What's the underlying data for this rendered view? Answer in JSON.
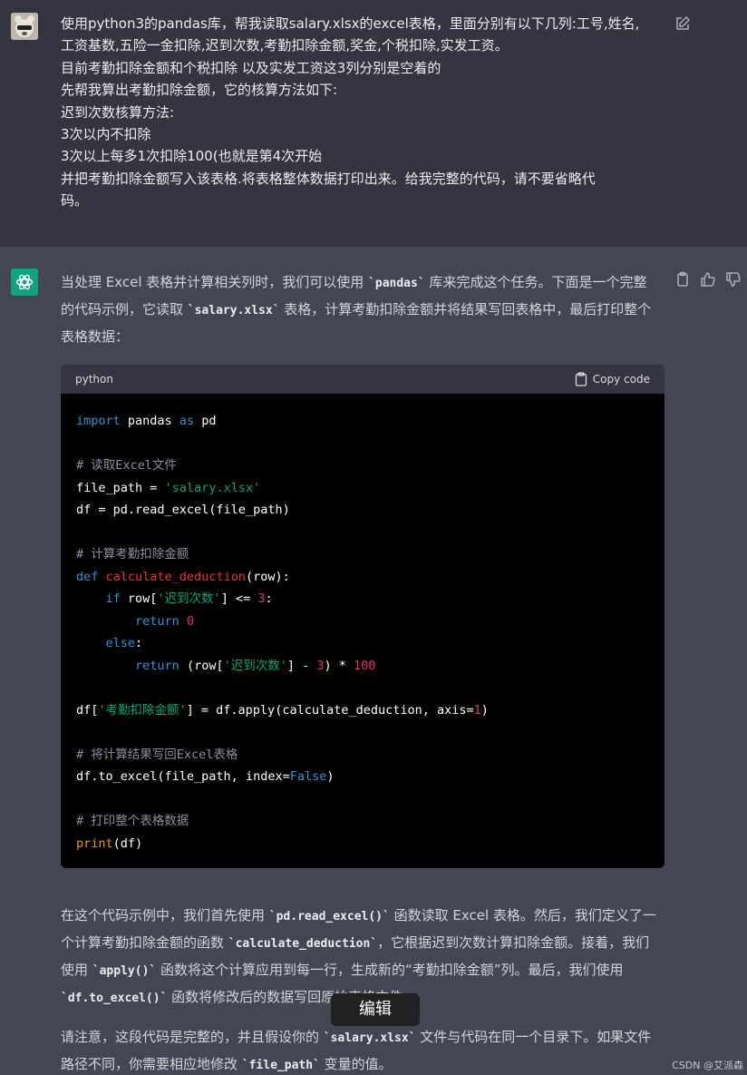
{
  "user": {
    "lines": [
      "使用python3的pandas库，帮我读取salary.xlsx的excel表格，里面分别有以下几列:工号,姓名,",
      "工资基数,五险一金扣除,迟到次数,考勤扣除金额,奖金,个税扣除,实发工资。",
      "目前考勤扣除金额和个税扣除 以及实发工资这3列分别是空着的",
      "先帮我算出考勤扣除金额，它的核算方法如下:",
      "迟到次数核算方法:",
      "3次以内不扣除",
      "3次以上每多1次扣除100(也就是第4次开始",
      "并把考勤扣除金额写入该表格.将表格整体数据打印出来。给我完整的代码，请不要省略代",
      "码。"
    ]
  },
  "assistant": {
    "intro": {
      "t1": "当处理 Excel 表格并计算相关列时，我们可以使用 ",
      "c1": "`pandas`",
      "t2": " 库来完成这个任务。下面是一个完整的代码示例，它读取 ",
      "c2": "`salary.xlsx`",
      "t3": " 表格，计算考勤扣除金额并将结果写回表格中，最后打印整个表格数据："
    },
    "code": {
      "language": "python",
      "copy_label": "Copy code",
      "l1": {
        "kw": "import",
        "t": " pandas ",
        "kw2": "as",
        "t2": " pd"
      },
      "c1": "# 读取Excel文件",
      "l2": {
        "t": "file_path = ",
        "s": "'salary.xlsx'"
      },
      "l3": "df = pd.read_excel(file_path)",
      "c2": "# 计算考勤扣除金额",
      "l4": {
        "kw": "def",
        "fn": "calculate_deduction",
        "t": "(row):"
      },
      "l5": {
        "kw": "if",
        "t": " row[",
        "s": "'迟到次数'",
        "t2": "] <= ",
        "n": "3",
        "t3": ":"
      },
      "l6": {
        "kw": "return",
        "n": "0"
      },
      "l7": {
        "kw": "else",
        "t": ":"
      },
      "l8": {
        "kw": "return",
        "t": " (row[",
        "s": "'迟到次数'",
        "t2": "] - ",
        "n": "3",
        "t3": ") * ",
        "n2": "100"
      },
      "l9": {
        "t": "df[",
        "s": "'考勤扣除金额'",
        "t2": "] = df.apply(calculate_deduction, axis=",
        "n": "1",
        "t3": ")"
      },
      "c3": "# 将计算结果写回Excel表格",
      "l10": {
        "t": "df.to_excel(file_path, index=",
        "kw": "False",
        "t2": ")"
      },
      "c4": "# 打印整个表格数据",
      "l11": {
        "bi": "print",
        "t": "(df)"
      }
    },
    "explain": {
      "t1": "在这个代码示例中，我们首先使用 ",
      "c1": "`pd.read_excel()`",
      "t2": " 函数读取 Excel 表格。然后，我们定义了一个计算考勤扣除金额的函数 ",
      "c2": "`calculate_deduction`",
      "t3": "，它根据迟到次数计算扣除金额。接着，我们使用 ",
      "c3": "`apply()`",
      "t4": " 函数将这个计算应用到每一行，生成新的“考勤扣除金额”列。最后，我们使用 ",
      "c4": "`df.to_excel()`",
      "t5": " 函数将修改后的数据写回原始表格文件。"
    },
    "note": {
      "t1": "请注意，这段代码是完整的，并且假设你的 ",
      "c1": "`salary.xlsx`",
      "t2": " 文件与代码在同一个目录下。如果文件路径不同，你需要相应地修改 ",
      "c2": "`file_path`",
      "t3": " 变量的值。"
    }
  },
  "tooltip": "编辑",
  "watermark": "CSDN @艾派森",
  "colors": {
    "user_bg": "#343541",
    "assistant_bg": "#444654",
    "brand": "#10a37f"
  }
}
